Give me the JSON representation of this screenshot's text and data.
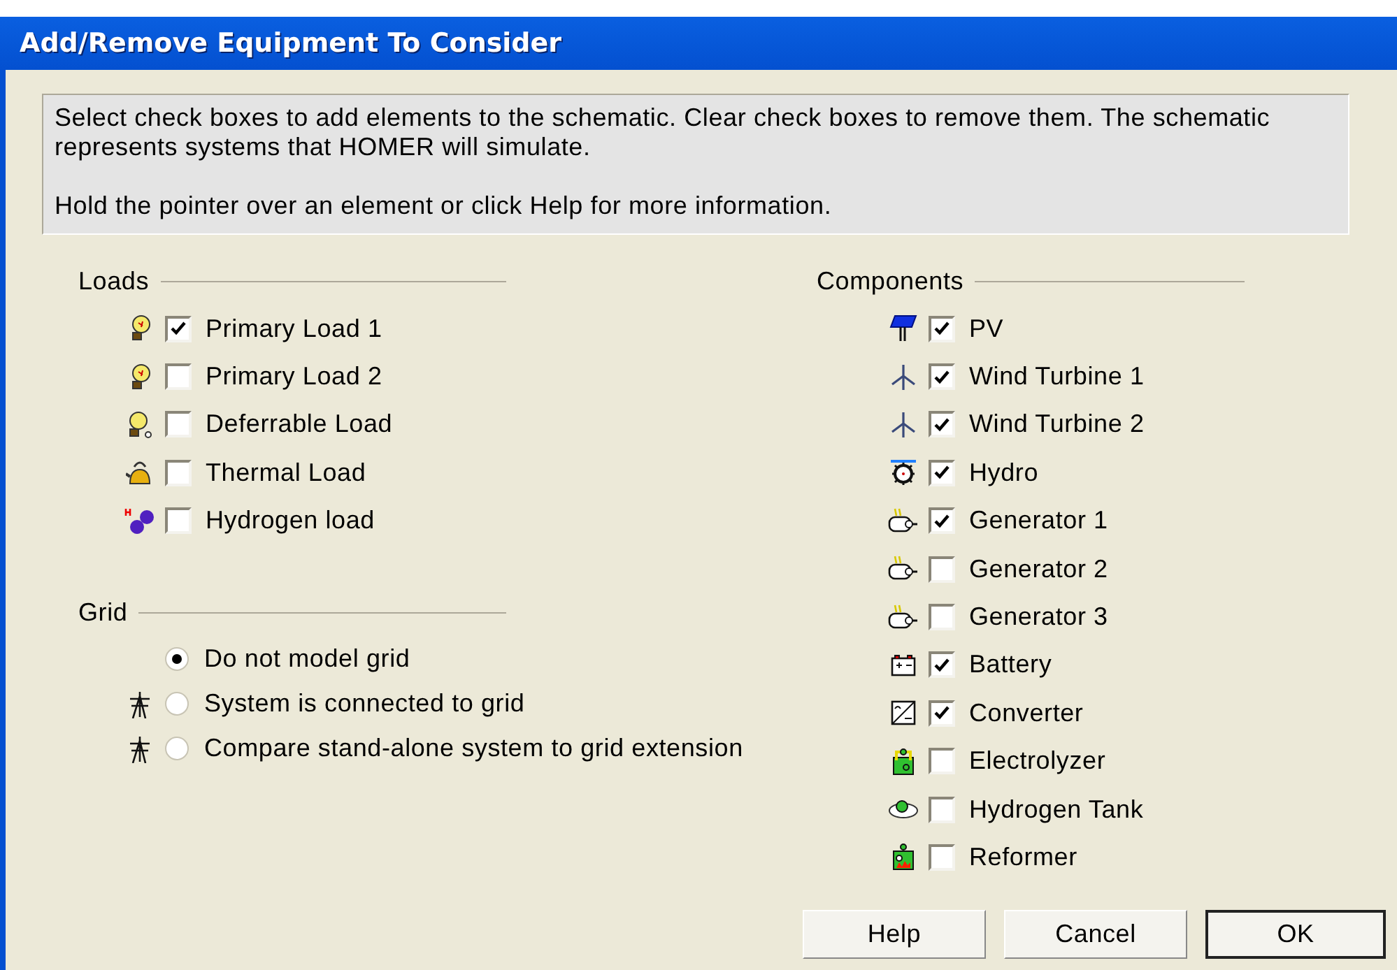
{
  "window": {
    "title": "Add/Remove Equipment To Consider"
  },
  "info": [
    "Select check boxes to add elements to the schematic. Clear check boxes to remove them. The schematic represents systems that HOMER will simulate.",
    "Hold the pointer over an element or click Help for more information."
  ],
  "loads": {
    "heading": "Loads",
    "items": [
      {
        "label": "Primary Load 1",
        "checked": true
      },
      {
        "label": "Primary Load 2",
        "checked": false
      },
      {
        "label": "Deferrable Load",
        "checked": false
      },
      {
        "label": "Thermal Load",
        "checked": false
      },
      {
        "label": "Hydrogen load",
        "checked": false
      }
    ]
  },
  "grid": {
    "heading": "Grid",
    "options": [
      {
        "label": "Do not model grid",
        "selected": true
      },
      {
        "label": "System is connected to grid",
        "selected": false
      },
      {
        "label": "Compare stand-alone system to grid extension",
        "selected": false
      }
    ]
  },
  "components": {
    "heading": "Components",
    "items": [
      {
        "label": "PV",
        "checked": true
      },
      {
        "label": "Wind Turbine 1",
        "checked": true
      },
      {
        "label": "Wind Turbine 2",
        "checked": true
      },
      {
        "label": "Hydro",
        "checked": true
      },
      {
        "label": "Generator 1",
        "checked": true
      },
      {
        "label": "Generator 2",
        "checked": false
      },
      {
        "label": "Generator 3",
        "checked": false
      },
      {
        "label": "Battery",
        "checked": true
      },
      {
        "label": "Converter",
        "checked": true
      },
      {
        "label": "Electrolyzer",
        "checked": false
      },
      {
        "label": "Hydrogen Tank",
        "checked": false
      },
      {
        "label": "Reformer",
        "checked": false
      }
    ]
  },
  "buttons": [
    {
      "label": "Help",
      "default": false
    },
    {
      "label": "Cancel",
      "default": false
    },
    {
      "label": "OK",
      "default": true
    }
  ]
}
